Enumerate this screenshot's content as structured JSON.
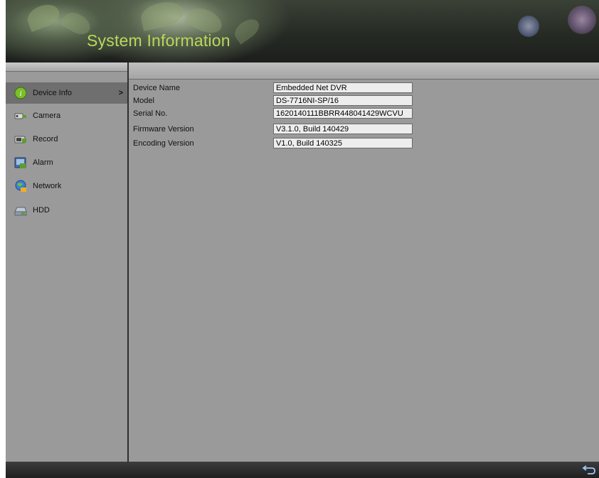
{
  "header": {
    "title": "System Information"
  },
  "sidebar": {
    "items": [
      {
        "label": "Device Info",
        "icon": "info-icon",
        "active": true,
        "chevron": ">"
      },
      {
        "label": "Camera",
        "icon": "camera-icon",
        "active": false
      },
      {
        "label": "Record",
        "icon": "record-icon",
        "active": false
      },
      {
        "label": "Alarm",
        "icon": "alarm-icon",
        "active": false
      },
      {
        "label": "Network",
        "icon": "network-icon",
        "active": false
      },
      {
        "label": "HDD",
        "icon": "hdd-icon",
        "active": false
      }
    ]
  },
  "device_info": {
    "rows": [
      {
        "label": "Device Name",
        "value": "Embedded Net DVR"
      },
      {
        "label": "Model",
        "value": "DS-7716NI-SP/16"
      },
      {
        "label": "Serial No.",
        "value": "1620140111BBRR448041429WCVU"
      },
      {
        "label": "Firmware Version",
        "value": "V3.1.0, Build 140429"
      },
      {
        "label": "Encoding Version",
        "value": "V1.0, Build 140325"
      }
    ]
  },
  "footer": {
    "back_icon": "back-arrow-icon"
  },
  "colors": {
    "title": "#b9d85a",
    "active_item": "#6f6f6f",
    "panel": "#9a9a9a",
    "field": "#ededed"
  }
}
